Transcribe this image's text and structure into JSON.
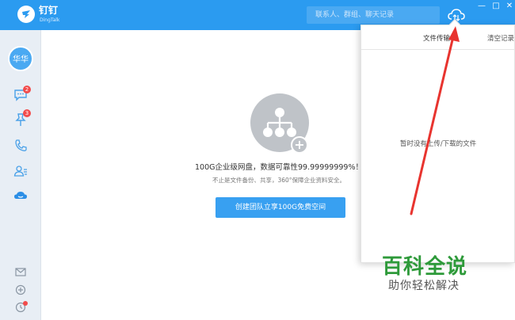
{
  "titlebar": {
    "brand_name": "钉钉",
    "brand_sub": "DingTalk",
    "search_placeholder": "联系人、群组、聊天记录",
    "window_controls": [
      "—",
      "□",
      "✕"
    ]
  },
  "sidebar": {
    "avatar_label": "华华",
    "items": [
      {
        "icon": "chat-icon",
        "badge": "2"
      },
      {
        "icon": "pin-icon",
        "badge": "3"
      },
      {
        "icon": "phone-icon",
        "badge": ""
      },
      {
        "icon": "contacts-icon",
        "badge": ""
      },
      {
        "icon": "cloud-disk-icon",
        "badge": ""
      }
    ],
    "bottom_items": [
      "mail-icon",
      "add-icon",
      "more-icon"
    ]
  },
  "main": {
    "headline": "100G企业级网盘，数据可靠性99.99999999%！",
    "subline": "不止是文件备份、共享，360°保障企业资料安全。",
    "create_button": "创建团队立享100G免费空间"
  },
  "transfer_panel": {
    "title": "文件传输",
    "clear_label": "清空记录",
    "empty_text": "暂时没有上传/下载的文件"
  },
  "watermark": {
    "title": "百科全说",
    "subtitle": "助你轻松解决"
  },
  "colors": {
    "primary": "#2b9bf0",
    "button": "#38a0f1",
    "annotation_arrow": "#e8342f",
    "watermark_green": "#2e9a3a"
  }
}
